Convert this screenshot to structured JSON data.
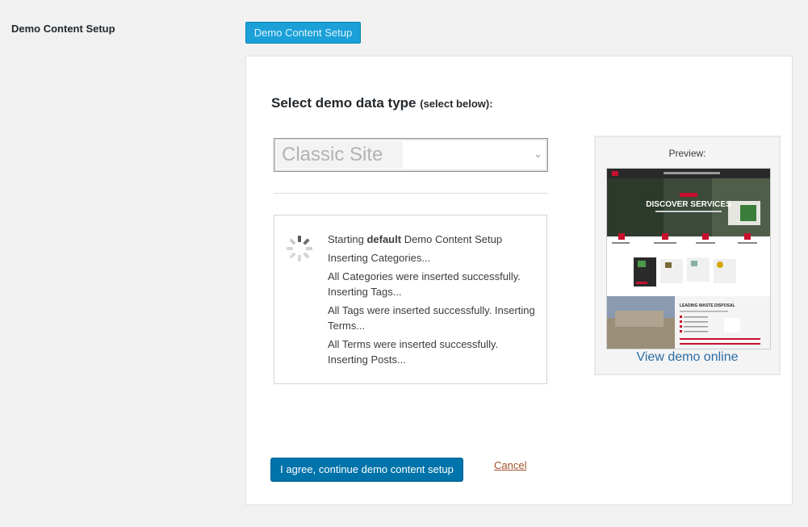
{
  "settings_row": {
    "label": "Demo Content Setup",
    "button_label": "Demo Content Setup"
  },
  "panel": {
    "heading_main": "Select demo data type",
    "heading_hint": "(select below):",
    "select": {
      "value": "Classic Site"
    },
    "log": {
      "line1_prefix": "Starting",
      "line1_bold": "default",
      "line1_suffix": "Demo Content Setup",
      "lines": [
        "Inserting Categories...",
        "All Categories were inserted successfully. Inserting Tags...",
        "All Tags were inserted successfully. Inserting Terms...",
        "All Terms were inserted successfully. Inserting Posts..."
      ]
    },
    "preview": {
      "label": "Preview:",
      "hero_text": "DISCOVER SERVICES",
      "section_title": "LEADING WASTE DISPOSAL",
      "view_demo_label": "View demo online"
    },
    "agree_button_label": "I agree, continue demo content setup",
    "cancel_label": "Cancel"
  },
  "colors": {
    "primary_button": "#0073aa",
    "secondary_button": "#1ba0d8",
    "link": "#2b6ca3",
    "cancel_link": "#a0522d",
    "accent_red": "#c8102e"
  }
}
